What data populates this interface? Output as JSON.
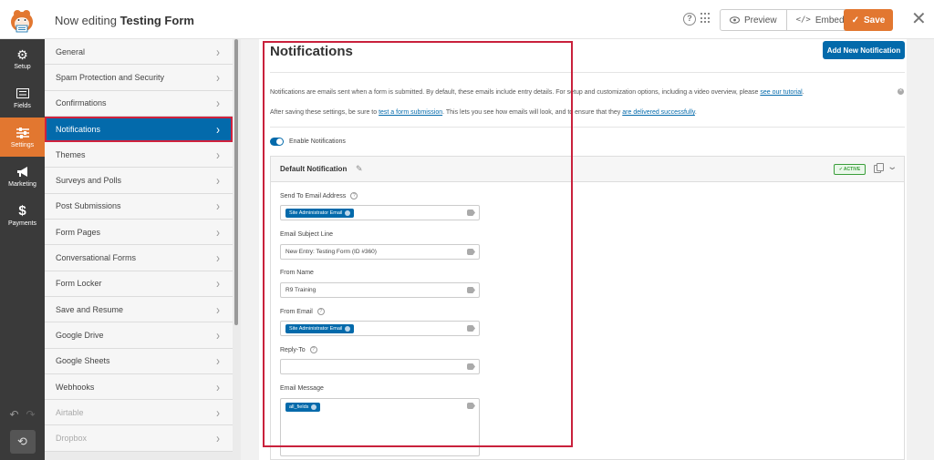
{
  "header": {
    "title_prefix": "Now editing",
    "form_name": "Testing Form",
    "preview_label": "Preview",
    "embed_label": "Embed",
    "save_label": "Save"
  },
  "rail": {
    "items": [
      {
        "label": "Setup",
        "icon": "gear-icon"
      },
      {
        "label": "Fields",
        "icon": "list-icon"
      },
      {
        "label": "Settings",
        "icon": "sliders-icon"
      },
      {
        "label": "Marketing",
        "icon": "megaphone-icon"
      },
      {
        "label": "Payments",
        "icon": "dollar-icon"
      }
    ],
    "active": "Settings"
  },
  "settings_nav": {
    "items": [
      {
        "label": "General"
      },
      {
        "label": "Spam Protection and Security"
      },
      {
        "label": "Confirmations"
      },
      {
        "label": "Notifications"
      },
      {
        "label": "Themes"
      },
      {
        "label": "Surveys and Polls"
      },
      {
        "label": "Post Submissions"
      },
      {
        "label": "Form Pages"
      },
      {
        "label": "Conversational Forms"
      },
      {
        "label": "Form Locker"
      },
      {
        "label": "Save and Resume"
      },
      {
        "label": "Google Drive"
      },
      {
        "label": "Google Sheets"
      },
      {
        "label": "Webhooks"
      },
      {
        "label": "Airtable"
      },
      {
        "label": "Dropbox"
      }
    ],
    "active": "Notifications"
  },
  "main": {
    "title": "Notifications",
    "add_button": "Add New Notification",
    "desc1_text": "Notifications are emails sent when a form is submitted. By default, these emails include entry details. For setup and customization options, including a video overview, please",
    "desc1_link": "see our tutorial",
    "desc2_a": "After saving these settings, be sure to",
    "desc2_link1": "test a form submission",
    "desc2_b": ". This lets you see how emails will look, and to ensure that they",
    "desc2_link2": "are delivered successfully",
    "enable_label": "Enable Notifications",
    "notification": {
      "title": "Default Notification",
      "status": "ACTIVE",
      "send_to_label": "Send To Email Address",
      "send_to_tag": "Site Administrator Email",
      "subject_label": "Email Subject Line",
      "subject_value": "New Entry: Testing Form (ID #360)",
      "from_name_label": "From Name",
      "from_name_value": "R9 Training",
      "from_email_label": "From Email",
      "from_email_tag": "Site Administrator Email",
      "reply_to_label": "Reply-To",
      "reply_to_value": "",
      "message_label": "Email Message",
      "message_tag": "all_fields"
    }
  },
  "colors": {
    "brand_orange": "#e27730",
    "brand_blue": "#036aab",
    "annotation_red": "#c9213c",
    "rail_bg": "#3a3a3a"
  }
}
